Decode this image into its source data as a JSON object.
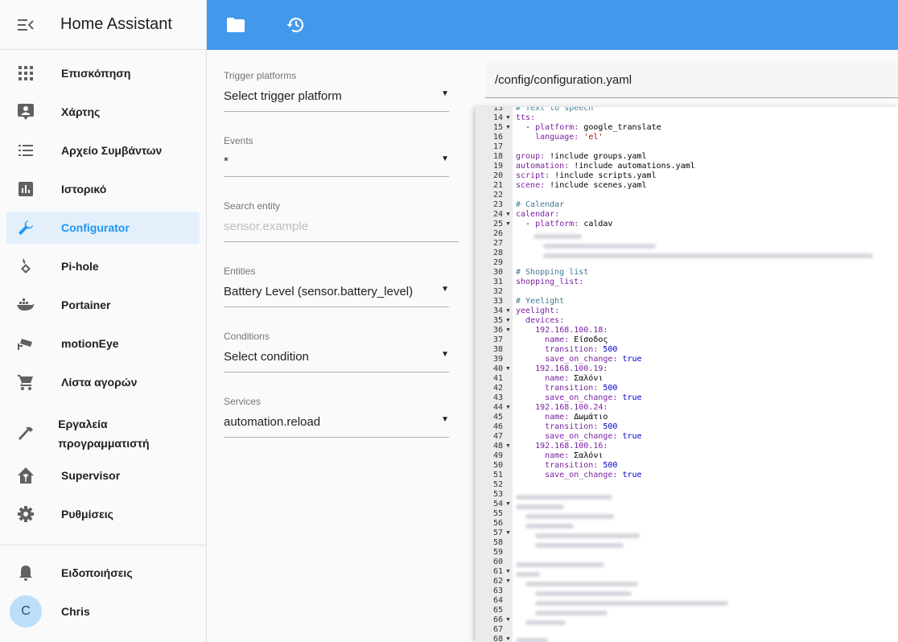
{
  "app": {
    "title": "Home Assistant"
  },
  "sidebar": {
    "items": [
      {
        "label": "Επισκόπηση",
        "icon": "grid-icon"
      },
      {
        "label": "Χάρτης",
        "icon": "map-person-icon"
      },
      {
        "label": "Αρχείο Συμβάντων",
        "icon": "list-icon"
      },
      {
        "label": "Ιστορικό",
        "icon": "chart-icon"
      },
      {
        "label": "Configurator",
        "icon": "wrench-icon",
        "active": true
      },
      {
        "label": "Pi-hole",
        "icon": "pihole-icon"
      },
      {
        "label": "Portainer",
        "icon": "docker-icon"
      },
      {
        "label": "motionEye",
        "icon": "cctv-icon"
      },
      {
        "label": "Λίστα αγορών",
        "icon": "cart-icon"
      },
      {
        "label": "Εργαλεία προγραμματιστή",
        "icon": "hammer-icon"
      },
      {
        "label": "Supervisor",
        "icon": "home-assistant-icon"
      },
      {
        "label": "Ρυθμίσεις",
        "icon": "gear-icon"
      }
    ],
    "notifications_label": "Ειδοποιήσεις",
    "user": {
      "initial": "C",
      "name": "Chris"
    }
  },
  "toolbar": {
    "icons": [
      "folder-icon",
      "history-icon"
    ]
  },
  "form": {
    "trigger_label": "Trigger platforms",
    "trigger_value": "Select trigger platform",
    "events_label": "Events",
    "events_value": "*",
    "search_label": "Search entity",
    "search_placeholder": "sensor.example",
    "entities_label": "Entities",
    "entities_value": "Battery Level (sensor.battery_level)",
    "conditions_label": "Conditions",
    "conditions_value": "Select condition",
    "services_label": "Services",
    "services_value": "automation.reload"
  },
  "editor": {
    "path": "/config/configuration.yaml",
    "lines": [
      {
        "n": "13",
        "fold": false,
        "parts": [
          [
            "c",
            "# Text to speech"
          ]
        ]
      },
      {
        "n": "14",
        "fold": true,
        "parts": [
          [
            "k",
            "tts:"
          ]
        ]
      },
      {
        "n": "15",
        "fold": true,
        "parts": [
          [
            "",
            "  - "
          ],
          [
            "k",
            "platform: "
          ],
          [
            "",
            "google_translate"
          ]
        ]
      },
      {
        "n": "16",
        "fold": false,
        "parts": [
          [
            "",
            "    "
          ],
          [
            "k",
            "language: "
          ],
          [
            "s",
            "'el'"
          ]
        ]
      },
      {
        "n": "17",
        "fold": false,
        "parts": []
      },
      {
        "n": "18",
        "fold": false,
        "parts": [
          [
            "k",
            "group: "
          ],
          [
            "",
            "!include groups.yaml"
          ]
        ]
      },
      {
        "n": "19",
        "fold": false,
        "parts": [
          [
            "k",
            "automation: "
          ],
          [
            "",
            "!include automations.yaml"
          ]
        ]
      },
      {
        "n": "20",
        "fold": false,
        "parts": [
          [
            "k",
            "script: "
          ],
          [
            "",
            "!include scripts.yaml"
          ]
        ]
      },
      {
        "n": "21",
        "fold": false,
        "parts": [
          [
            "k",
            "scene: "
          ],
          [
            "",
            "!include scenes.yaml"
          ]
        ]
      },
      {
        "n": "22",
        "fold": false,
        "parts": []
      },
      {
        "n": "23",
        "fold": false,
        "parts": [
          [
            "c",
            "# Calendar"
          ]
        ]
      },
      {
        "n": "24",
        "fold": true,
        "parts": [
          [
            "k",
            "calendar:"
          ]
        ]
      },
      {
        "n": "25",
        "fold": true,
        "parts": [
          [
            "",
            "  - "
          ],
          [
            "k",
            "platform: "
          ],
          [
            "",
            "caldav"
          ]
        ]
      },
      {
        "n": "26",
        "fold": false,
        "parts": []
      },
      {
        "n": "27",
        "fold": false,
        "parts": []
      },
      {
        "n": "28",
        "fold": false,
        "parts": []
      },
      {
        "n": "29",
        "fold": false,
        "parts": []
      },
      {
        "n": "30",
        "fold": false,
        "parts": [
          [
            "c",
            "# Shopping list"
          ]
        ]
      },
      {
        "n": "31",
        "fold": false,
        "parts": [
          [
            "k",
            "shopping_list:"
          ]
        ]
      },
      {
        "n": "32",
        "fold": false,
        "parts": []
      },
      {
        "n": "33",
        "fold": false,
        "parts": [
          [
            "c",
            "# Yeelight"
          ]
        ]
      },
      {
        "n": "34",
        "fold": true,
        "parts": [
          [
            "k",
            "yeelight:"
          ]
        ]
      },
      {
        "n": "35",
        "fold": true,
        "parts": [
          [
            "",
            "  "
          ],
          [
            "k",
            "devices:"
          ]
        ]
      },
      {
        "n": "36",
        "fold": true,
        "parts": [
          [
            "",
            "    "
          ],
          [
            "k",
            "192.168.100.18:"
          ]
        ]
      },
      {
        "n": "37",
        "fold": false,
        "parts": [
          [
            "",
            "      "
          ],
          [
            "k",
            "name: "
          ],
          [
            "",
            "Είσοδος"
          ]
        ]
      },
      {
        "n": "38",
        "fold": false,
        "parts": [
          [
            "",
            "      "
          ],
          [
            "k",
            "transition: "
          ],
          [
            "n",
            "500"
          ]
        ]
      },
      {
        "n": "39",
        "fold": false,
        "parts": [
          [
            "",
            "      "
          ],
          [
            "k",
            "save_on_change: "
          ],
          [
            "n",
            "true"
          ]
        ]
      },
      {
        "n": "40",
        "fold": true,
        "parts": [
          [
            "",
            "    "
          ],
          [
            "k",
            "192.168.100.19:"
          ]
        ]
      },
      {
        "n": "41",
        "fold": false,
        "parts": [
          [
            "",
            "      "
          ],
          [
            "k",
            "name: "
          ],
          [
            "",
            "Σαλόνι"
          ]
        ]
      },
      {
        "n": "42",
        "fold": false,
        "parts": [
          [
            "",
            "      "
          ],
          [
            "k",
            "transition: "
          ],
          [
            "n",
            "500"
          ]
        ]
      },
      {
        "n": "43",
        "fold": false,
        "parts": [
          [
            "",
            "      "
          ],
          [
            "k",
            "save_on_change: "
          ],
          [
            "n",
            "true"
          ]
        ]
      },
      {
        "n": "44",
        "fold": true,
        "parts": [
          [
            "",
            "    "
          ],
          [
            "k",
            "192.168.100.24:"
          ]
        ]
      },
      {
        "n": "45",
        "fold": false,
        "parts": [
          [
            "",
            "      "
          ],
          [
            "k",
            "name: "
          ],
          [
            "",
            "Δωμάτιο"
          ]
        ]
      },
      {
        "n": "46",
        "fold": false,
        "parts": [
          [
            "",
            "      "
          ],
          [
            "k",
            "transition: "
          ],
          [
            "n",
            "500"
          ]
        ]
      },
      {
        "n": "47",
        "fold": false,
        "parts": [
          [
            "",
            "      "
          ],
          [
            "k",
            "save_on_change: "
          ],
          [
            "n",
            "true"
          ]
        ]
      },
      {
        "n": "48",
        "fold": true,
        "parts": [
          [
            "",
            "    "
          ],
          [
            "k",
            "192.168.100.16:"
          ]
        ]
      },
      {
        "n": "49",
        "fold": false,
        "parts": [
          [
            "",
            "      "
          ],
          [
            "k",
            "name: "
          ],
          [
            "",
            "Σαλόνι"
          ]
        ]
      },
      {
        "n": "50",
        "fold": false,
        "parts": [
          [
            "",
            "      "
          ],
          [
            "k",
            "transition: "
          ],
          [
            "n",
            "500"
          ]
        ]
      },
      {
        "n": "51",
        "fold": false,
        "parts": [
          [
            "",
            "      "
          ],
          [
            "k",
            "save_on_change: "
          ],
          [
            "n",
            "true"
          ]
        ]
      },
      {
        "n": "52",
        "fold": false,
        "parts": []
      },
      {
        "n": "53",
        "fold": false,
        "parts": []
      },
      {
        "n": "54",
        "fold": true,
        "parts": []
      },
      {
        "n": "55",
        "fold": false,
        "parts": []
      },
      {
        "n": "56",
        "fold": false,
        "parts": []
      },
      {
        "n": "57",
        "fold": true,
        "parts": []
      },
      {
        "n": "58",
        "fold": false,
        "parts": []
      },
      {
        "n": "59",
        "fold": false,
        "parts": []
      },
      {
        "n": "60",
        "fold": false,
        "parts": []
      },
      {
        "n": "61",
        "fold": true,
        "parts": []
      },
      {
        "n": "62",
        "fold": true,
        "parts": []
      },
      {
        "n": "63",
        "fold": false,
        "parts": []
      },
      {
        "n": "64",
        "fold": false,
        "parts": []
      },
      {
        "n": "65",
        "fold": false,
        "parts": []
      },
      {
        "n": "66",
        "fold": true,
        "parts": []
      },
      {
        "n": "67",
        "fold": false,
        "parts": []
      },
      {
        "n": "68",
        "fold": true,
        "parts": []
      }
    ]
  }
}
